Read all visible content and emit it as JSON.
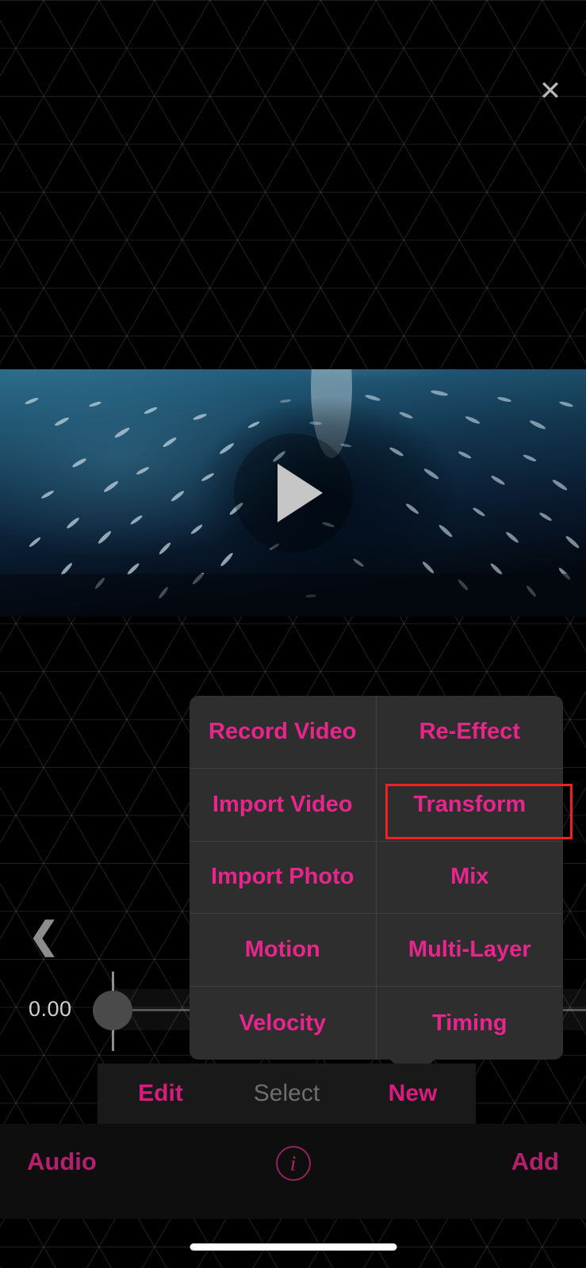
{
  "app": {
    "background_color": "#000000",
    "accent_color": "#e8258c",
    "highlight_color": "#f42020"
  },
  "header": {
    "close_icon": "close-icon",
    "close_glyph": "✕"
  },
  "preview": {
    "play_icon": "play-icon",
    "scene_description": "underwater school of fish",
    "water_top_color": "#2a6b8a",
    "water_bottom_color": "#040a14"
  },
  "timeline": {
    "back_glyph": "❮",
    "time_value": "0.00",
    "playhead_position_percent": 0
  },
  "popup": {
    "cells": [
      {
        "label": "Record Video",
        "column": "left",
        "highlighted": false
      },
      {
        "label": "Re-Effect",
        "column": "right",
        "highlighted": false
      },
      {
        "label": "Import Video",
        "column": "left",
        "highlighted": false
      },
      {
        "label": "Transform",
        "column": "right",
        "highlighted": true
      },
      {
        "label": "Import Photo",
        "column": "left",
        "highlighted": false
      },
      {
        "label": "Mix",
        "column": "right",
        "highlighted": false
      },
      {
        "label": "Motion",
        "column": "left",
        "highlighted": false
      },
      {
        "label": "Multi-Layer",
        "column": "right",
        "highlighted": false
      },
      {
        "label": "Velocity",
        "column": "left",
        "highlighted": false
      },
      {
        "label": "Timing",
        "column": "right",
        "highlighted": false
      }
    ]
  },
  "tabs": [
    {
      "label": "Edit",
      "active": true
    },
    {
      "label": "Select",
      "active": false
    },
    {
      "label": "New",
      "active": true
    }
  ],
  "bottom_bar": {
    "audio_label": "Audio",
    "info_glyph": "i",
    "add_label": "Add"
  }
}
